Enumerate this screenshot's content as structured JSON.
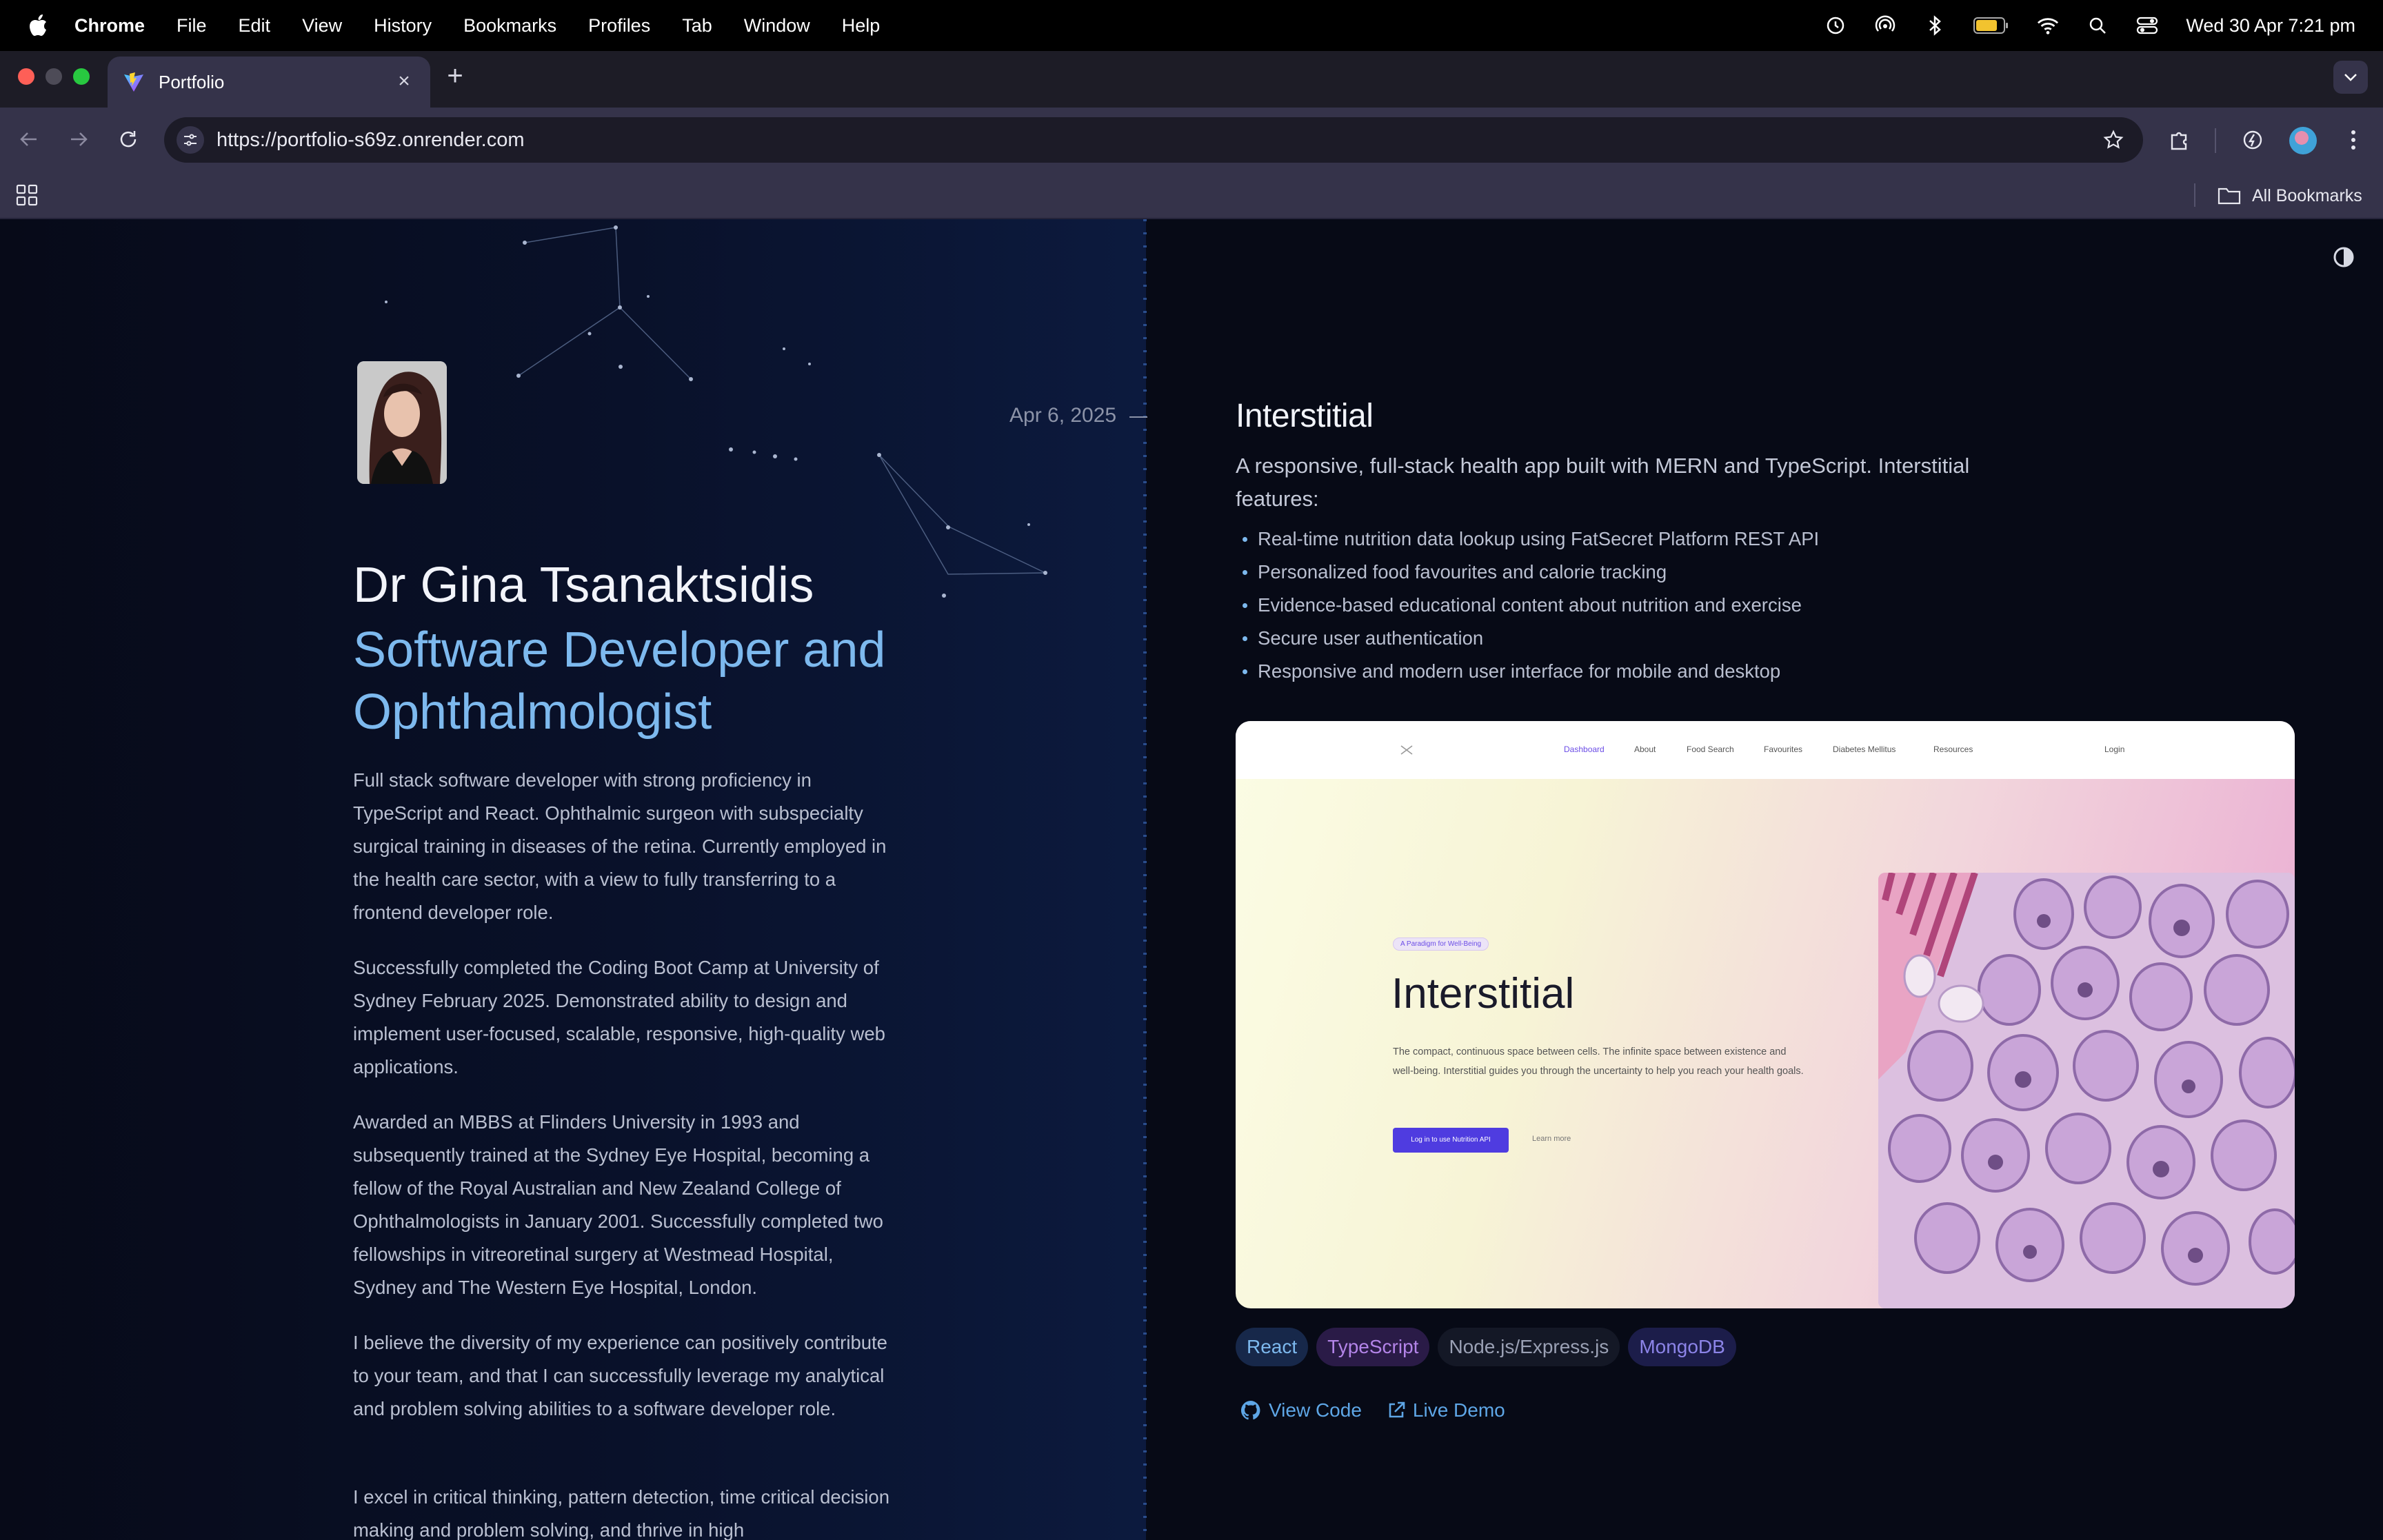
{
  "menubar": {
    "app": "Chrome",
    "items": [
      "File",
      "Edit",
      "View",
      "History",
      "Bookmarks",
      "Profiles",
      "Tab",
      "Window",
      "Help"
    ],
    "clock": "Wed 30 Apr  7:21 pm",
    "icons": [
      "time-machine-icon",
      "airdrop-icon",
      "bluetooth-icon",
      "battery-icon",
      "wifi-icon",
      "spotlight-icon",
      "control-center-icon"
    ]
  },
  "tabs": [
    {
      "title": "Portfolio",
      "favicon": "vite-logo-icon",
      "active": true
    }
  ],
  "toolbar": {
    "url": "https://portfolio-s69z.onrender.com"
  },
  "bookmarks": {
    "all_label": "All Bookmarks"
  },
  "profile": {
    "name": "Dr Gina Tsanaktsidis",
    "role": "Software Developer and Ophthalmologist",
    "bio": [
      "Full stack software developer with strong proficiency in TypeScript and React. Ophthalmic surgeon with subspecialty surgical training in diseases of the retina. Currently employed in the health care sector, with a view to fully transferring to a frontend developer role.",
      "Successfully completed the Coding Boot Camp at University of Sydney February 2025. Demonstrated ability to design and implement user-focused, scalable, responsive, high-quality web applications.",
      "Awarded an MBBS at Flinders University in 1993 and subsequently trained at the Sydney Eye Hospital, becoming a fellow of the Royal Australian and New Zealand College of Ophthalmologists in January 2001. Successfully completed two fellowships in vitreoretinal surgery at Westmead Hospital, Sydney and The Western Eye Hospital, London.",
      "I believe the diversity of my experience can positively contribute to your team, and that I can successfully leverage my analytical and problem solving abilities to a software developer role.",
      "I excel in critical thinking, pattern detection, time critical decision making and problem solving, and thrive in high"
    ]
  },
  "project": {
    "date": "Apr 6, 2025",
    "title": "Interstitial",
    "description": "A responsive, full-stack health app built with MERN and TypeScript. Interstitial features:",
    "features": [
      "Real-time nutrition data lookup using FatSecret Platform REST API",
      "Personalized food favourites and calorie tracking",
      "Evidence-based educational content about nutrition and exercise",
      "Secure user authentication",
      "Responsive and modern user interface for mobile and desktop"
    ],
    "preview": {
      "nav": [
        "Dashboard",
        "About",
        "Food Search",
        "Favourites",
        "Diabetes Mellitus",
        "Resources"
      ],
      "login": "Login",
      "badge": "A Paradigm for Well-Being",
      "title": "Interstitial",
      "text": "The compact, continuous space between cells. The infinite space between existence and well-being. Interstitial guides you through the uncertainty to help you reach your health goals.",
      "button": "Log in to use Nutrition API",
      "learn": "Learn more"
    },
    "tags": [
      {
        "label": "React",
        "color": "#7db9ee",
        "bg": "#17284a"
      },
      {
        "label": "TypeScript",
        "color": "#b384e8",
        "bg": "#2a1b47"
      },
      {
        "label": "Node.js/Express.js",
        "color": "#9aa0b4",
        "bg": "#141826"
      },
      {
        "label": "MongoDB",
        "color": "#8c84e8",
        "bg": "#1c1d4a"
      }
    ],
    "links": {
      "code": "View Code",
      "demo": "Live Demo"
    }
  }
}
